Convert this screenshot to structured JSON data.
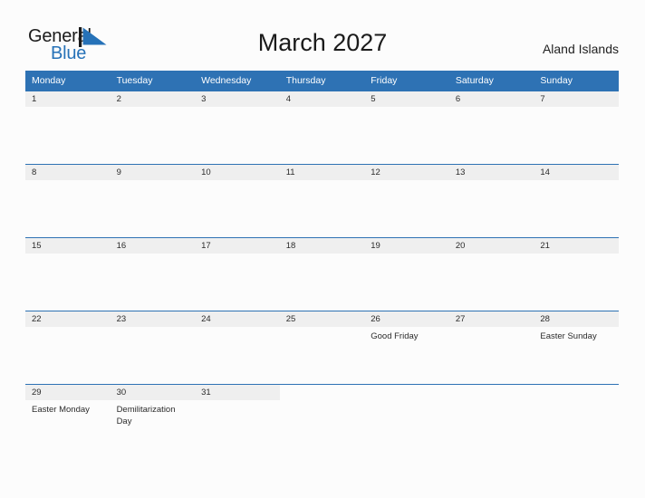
{
  "brand": {
    "word_one": "General",
    "word_two": "Blue",
    "mark": "triangle-flag-logo",
    "color": "#2672b8"
  },
  "header": {
    "title": "March 2027",
    "region": "Aland Islands"
  },
  "calendar": {
    "accent_color": "#2e72b4",
    "daynum_band_color": "#efefef",
    "month": "March",
    "year": 2027,
    "weekday_headers": [
      "Monday",
      "Tuesday",
      "Wednesday",
      "Thursday",
      "Friday",
      "Saturday",
      "Sunday"
    ],
    "weeks": [
      [
        {
          "day": "1",
          "event": ""
        },
        {
          "day": "2",
          "event": ""
        },
        {
          "day": "3",
          "event": ""
        },
        {
          "day": "4",
          "event": ""
        },
        {
          "day": "5",
          "event": ""
        },
        {
          "day": "6",
          "event": ""
        },
        {
          "day": "7",
          "event": ""
        }
      ],
      [
        {
          "day": "8",
          "event": ""
        },
        {
          "day": "9",
          "event": ""
        },
        {
          "day": "10",
          "event": ""
        },
        {
          "day": "11",
          "event": ""
        },
        {
          "day": "12",
          "event": ""
        },
        {
          "day": "13",
          "event": ""
        },
        {
          "day": "14",
          "event": ""
        }
      ],
      [
        {
          "day": "15",
          "event": ""
        },
        {
          "day": "16",
          "event": ""
        },
        {
          "day": "17",
          "event": ""
        },
        {
          "day": "18",
          "event": ""
        },
        {
          "day": "19",
          "event": ""
        },
        {
          "day": "20",
          "event": ""
        },
        {
          "day": "21",
          "event": ""
        }
      ],
      [
        {
          "day": "22",
          "event": ""
        },
        {
          "day": "23",
          "event": ""
        },
        {
          "day": "24",
          "event": ""
        },
        {
          "day": "25",
          "event": ""
        },
        {
          "day": "26",
          "event": "Good Friday"
        },
        {
          "day": "27",
          "event": ""
        },
        {
          "day": "28",
          "event": "Easter Sunday"
        }
      ],
      [
        {
          "day": "29",
          "event": "Easter Monday"
        },
        {
          "day": "30",
          "event": "Demilitarization Day"
        },
        {
          "day": "31",
          "event": ""
        },
        {
          "day": "",
          "event": ""
        },
        {
          "day": "",
          "event": ""
        },
        {
          "day": "",
          "event": ""
        },
        {
          "day": "",
          "event": ""
        }
      ]
    ]
  }
}
